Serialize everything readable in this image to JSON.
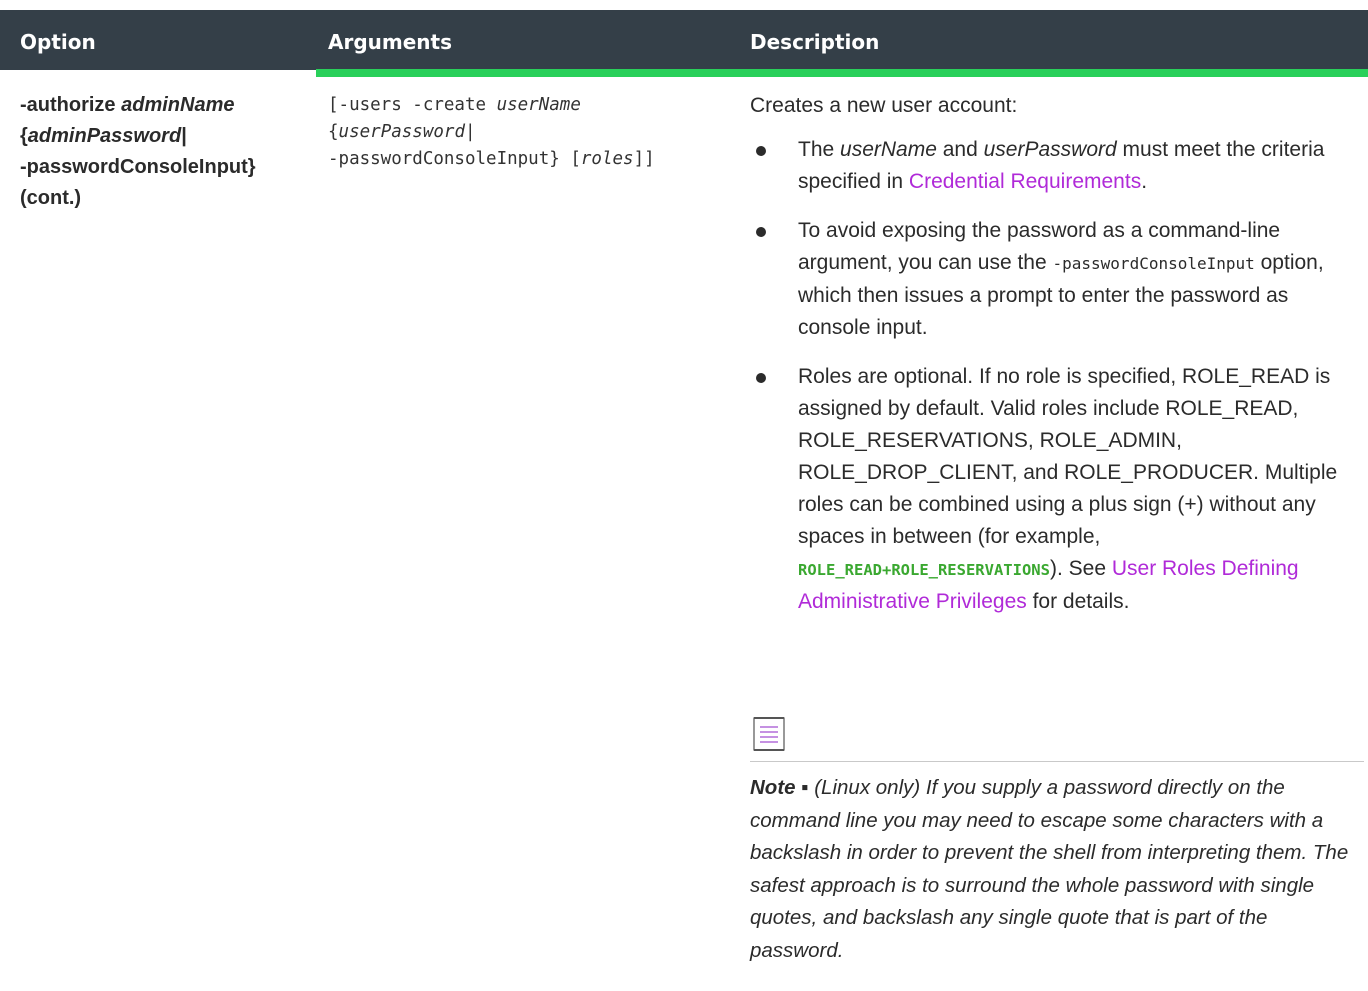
{
  "headers": {
    "option": "Option",
    "arguments": "Arguments",
    "description": "Description"
  },
  "option": {
    "flag": "-authorize",
    "admin_name": "adminName",
    "brace_open": "{",
    "admin_password": "adminPassword",
    "pipe": "|",
    "console_input": "-passwordConsoleInput}",
    "cont": "(cont.)"
  },
  "arguments": {
    "prefix": "[-users -create ",
    "user_name": "userName",
    "brace_open": "{",
    "user_password": "userPassword",
    "pipe": "|",
    "line3_prefix": "-passwordConsoleInput} [",
    "roles": "roles",
    "line3_suffix": "]]"
  },
  "description": {
    "intro": "Creates a new user account:",
    "bullet1": {
      "t1": "The ",
      "user_name": "userName",
      "t2": " and ",
      "user_password": "userPassword",
      "t3": " must meet the criteria specified in ",
      "link": "Credential Requirements",
      "t4": "."
    },
    "bullet2": {
      "t1": "To avoid exposing the password as a command-line argument, you can use the ",
      "code": "-passwordConsoleInput",
      "t2": " option, which then issues a prompt to enter the password as console input."
    },
    "bullet3": {
      "t1": "Roles are optional. If no role is specified, ROLE_READ is assigned by default. Valid roles include ROLE_READ, ROLE_RESERVATIONS, ROLE_ADMIN, ROLE_DROP_CLIENT, and ROLE_PRODUCER. Multiple roles can be combined using a plus sign (+) without any spaces in between (for example, ",
      "code": "ROLE_READ+ROLE_RESERVATIONS",
      "t2": "). See ",
      "link": "User Roles Defining Administrative Privileges",
      "t3": " for details."
    },
    "note": {
      "label": "Note",
      "separator": " ▪ ",
      "text": "(Linux only) If you supply a password directly on the command line you may need to escape some characters with a backslash in order to prevent the shell from interpreting them. The safest approach is to surround the whole password with single quotes, and backslash any single quote that is part of the password."
    }
  },
  "colors": {
    "header_bg": "#343f48",
    "accent_bar": "#29d05a",
    "link": "#b02ad8",
    "code_green": "#3aa830"
  },
  "icons": {
    "note": "note-document-icon"
  }
}
